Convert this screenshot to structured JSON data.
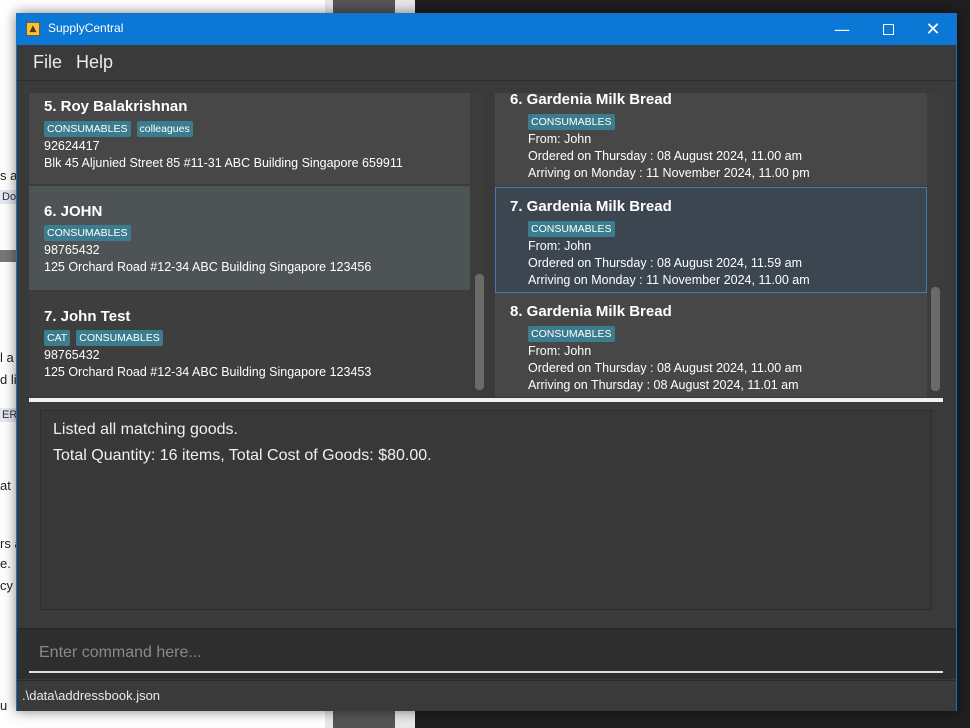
{
  "app": {
    "title": "SupplyCentral"
  },
  "menu": {
    "items": [
      "File",
      "Help"
    ]
  },
  "background": {
    "fragments": [
      "s a",
      "Doc",
      "l a",
      "d li",
      "ER_",
      "at",
      "rs a",
      "e.",
      "cy",
      "u"
    ]
  },
  "persons": [
    {
      "name": "5. Roy Balakrishnan",
      "tags": [
        "CONSUMABLES",
        "colleagues"
      ],
      "phone": "92624417",
      "address": "Blk 45 Aljunied Street 85 #11-31 ABC Building Singapore 659911"
    },
    {
      "name": "6. JOHN",
      "tags": [
        "CONSUMABLES"
      ],
      "phone": "98765432",
      "address": "125 Orchard Road #12-34 ABC Building Singapore 123456"
    },
    {
      "name": "7. John Test",
      "tags": [
        "CAT",
        "CONSUMABLES"
      ],
      "phone": "98765432",
      "address": "125 Orchard Road #12-34 ABC Building Singapore 123453"
    }
  ],
  "goods": [
    {
      "name": "6. Gardenia Milk Bread",
      "tags": [
        "CONSUMABLES"
      ],
      "from": "From: John",
      "ordered": "Ordered on Thursday : 08 August 2024, 11.00 am",
      "arriving": "Arriving on Monday : 11 November 2024, 11.00 pm"
    },
    {
      "name": "7. Gardenia Milk Bread",
      "tags": [
        "CONSUMABLES"
      ],
      "from": "From: John",
      "ordered": "Ordered on Thursday : 08 August 2024, 11.59 am",
      "arriving": "Arriving on Monday : 11 November 2024, 11.00 am"
    },
    {
      "name": "8. Gardenia Milk Bread",
      "tags": [
        "CONSUMABLES"
      ],
      "from": "From: John",
      "ordered": "Ordered on Thursday : 08 August 2024, 11.00 am",
      "arriving": "Arriving on Thursday : 08 August 2024, 11.01 am"
    }
  ],
  "result": {
    "lines": [
      "Listed all matching goods.",
      "Total Quantity: 16 items, Total Cost of Goods: $80.00."
    ]
  },
  "command": {
    "placeholder": "Enter command here...",
    "value": ""
  },
  "status": {
    "path": ".\\data\\addressbook.json"
  },
  "colors": {
    "titlebar": "#0a78d4",
    "tag": "#3b7d8f",
    "selected_border": "#3d7cb8"
  }
}
